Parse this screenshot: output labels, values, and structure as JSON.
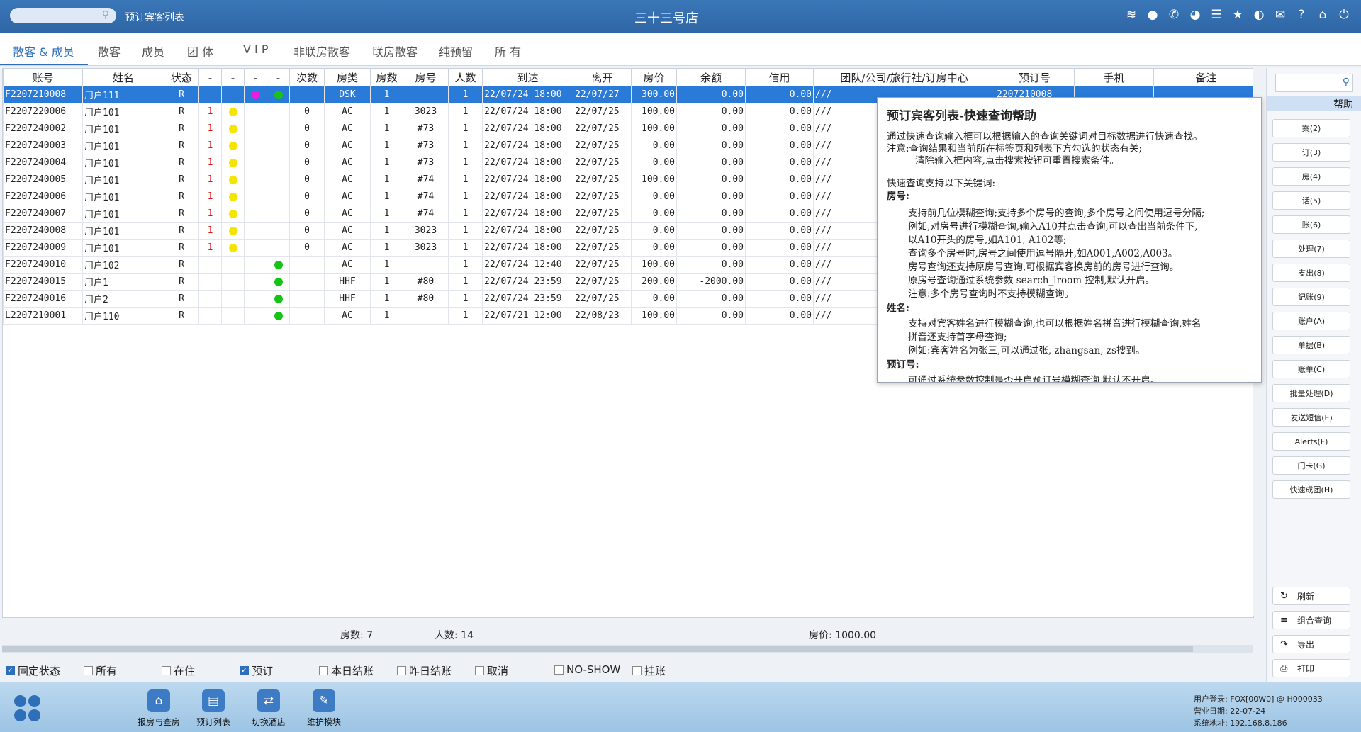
{
  "header": {
    "breadcrumb": "预订宾客列表",
    "store_name": "三十三号店",
    "icons": [
      "wifi-icon",
      "chat-icon",
      "phone-icon",
      "palette-icon",
      "menu-icon",
      "star-icon",
      "theme-icon",
      "mail-icon",
      "help-icon",
      "home-icon",
      "power-icon"
    ]
  },
  "tabs": [
    "散客 & 成员",
    "散客",
    "成员",
    "团 体",
    "V I P",
    "非联房散客",
    "联房散客",
    "纯预留",
    "所 有"
  ],
  "table": {
    "columns": [
      "账号",
      "姓名",
      "状态",
      "-",
      "-",
      "-",
      "-",
      "次数",
      "房类",
      "房数",
      "房号",
      "人数",
      "到达",
      "离开",
      "房价",
      "余额",
      "信用",
      "团队/公司/旅行社/订房中心",
      "预订号",
      "手机",
      "备注"
    ],
    "rows": [
      {
        "id": "F2207210008",
        "name": "用户111",
        "status": "R",
        "n1": "",
        "d1": "",
        "d2": "magenta",
        "d3": "green",
        "times": "",
        "type": "DSK",
        "rooms": "1",
        "roomno": "",
        "people": "1",
        "arrive": "22/07/24 18:00",
        "leave": "22/07/27",
        "price": "300.00",
        "balance": "0.00",
        "credit": "0.00",
        "group": "///",
        "resno": "2207210008",
        "mobile": "",
        "note": ""
      },
      {
        "id": "F2207220006",
        "name": "用户101",
        "status": "R",
        "n1": "1",
        "d1": "yellow",
        "d2": "",
        "d3": "",
        "times": "0",
        "type": "AC",
        "rooms": "1",
        "roomno": "3023",
        "people": "1",
        "arrive": "22/07/24 18:00",
        "leave": "22/07/25",
        "price": "100.00",
        "balance": "0.00",
        "credit": "0.00",
        "group": "///",
        "resno": "",
        "mobile": "",
        "note": ""
      },
      {
        "id": "F2207240002",
        "name": "用户101",
        "status": "R",
        "n1": "1",
        "d1": "yellow",
        "d2": "",
        "d3": "",
        "times": "0",
        "type": "AC",
        "rooms": "1",
        "roomno": "#73",
        "people": "1",
        "arrive": "22/07/24 18:00",
        "leave": "22/07/25",
        "price": "100.00",
        "balance": "0.00",
        "credit": "0.00",
        "group": "///",
        "resno": "",
        "mobile": "",
        "note": ""
      },
      {
        "id": "F2207240003",
        "name": "用户101",
        "status": "R",
        "n1": "1",
        "d1": "yellow",
        "d2": "",
        "d3": "",
        "times": "0",
        "type": "AC",
        "rooms": "1",
        "roomno": "#73",
        "people": "1",
        "arrive": "22/07/24 18:00",
        "leave": "22/07/25",
        "price": "0.00",
        "balance": "0.00",
        "credit": "0.00",
        "group": "///",
        "resno": "",
        "mobile": "",
        "note": ""
      },
      {
        "id": "F2207240004",
        "name": "用户101",
        "status": "R",
        "n1": "1",
        "d1": "yellow",
        "d2": "",
        "d3": "",
        "times": "0",
        "type": "AC",
        "rooms": "1",
        "roomno": "#73",
        "people": "1",
        "arrive": "22/07/24 18:00",
        "leave": "22/07/25",
        "price": "0.00",
        "balance": "0.00",
        "credit": "0.00",
        "group": "///",
        "resno": "",
        "mobile": "",
        "note": ""
      },
      {
        "id": "F2207240005",
        "name": "用户101",
        "status": "R",
        "n1": "1",
        "d1": "yellow",
        "d2": "",
        "d3": "",
        "times": "0",
        "type": "AC",
        "rooms": "1",
        "roomno": "#74",
        "people": "1",
        "arrive": "22/07/24 18:00",
        "leave": "22/07/25",
        "price": "100.00",
        "balance": "0.00",
        "credit": "0.00",
        "group": "///",
        "resno": "",
        "mobile": "",
        "note": ""
      },
      {
        "id": "F2207240006",
        "name": "用户101",
        "status": "R",
        "n1": "1",
        "d1": "yellow",
        "d2": "",
        "d3": "",
        "times": "0",
        "type": "AC",
        "rooms": "1",
        "roomno": "#74",
        "people": "1",
        "arrive": "22/07/24 18:00",
        "leave": "22/07/25",
        "price": "0.00",
        "balance": "0.00",
        "credit": "0.00",
        "group": "///",
        "resno": "",
        "mobile": "",
        "note": ""
      },
      {
        "id": "F2207240007",
        "name": "用户101",
        "status": "R",
        "n1": "1",
        "d1": "yellow",
        "d2": "",
        "d3": "",
        "times": "0",
        "type": "AC",
        "rooms": "1",
        "roomno": "#74",
        "people": "1",
        "arrive": "22/07/24 18:00",
        "leave": "22/07/25",
        "price": "0.00",
        "balance": "0.00",
        "credit": "0.00",
        "group": "///",
        "resno": "",
        "mobile": "",
        "note": ""
      },
      {
        "id": "F2207240008",
        "name": "用户101",
        "status": "R",
        "n1": "1",
        "d1": "yellow",
        "d2": "",
        "d3": "",
        "times": "0",
        "type": "AC",
        "rooms": "1",
        "roomno": "3023",
        "people": "1",
        "arrive": "22/07/24 18:00",
        "leave": "22/07/25",
        "price": "0.00",
        "balance": "0.00",
        "credit": "0.00",
        "group": "///",
        "resno": "",
        "mobile": "",
        "note": ""
      },
      {
        "id": "F2207240009",
        "name": "用户101",
        "status": "R",
        "n1": "1",
        "d1": "yellow",
        "d2": "",
        "d3": "",
        "times": "0",
        "type": "AC",
        "rooms": "1",
        "roomno": "3023",
        "people": "1",
        "arrive": "22/07/24 18:00",
        "leave": "22/07/25",
        "price": "0.00",
        "balance": "0.00",
        "credit": "0.00",
        "group": "///",
        "resno": "",
        "mobile": "",
        "note": ""
      },
      {
        "id": "F2207240010",
        "name": "用户102",
        "status": "R",
        "n1": "",
        "d1": "",
        "d2": "",
        "d3": "green",
        "times": "",
        "type": "AC",
        "rooms": "1",
        "roomno": "",
        "people": "1",
        "arrive": "22/07/24 12:40",
        "leave": "22/07/25",
        "price": "100.00",
        "balance": "0.00",
        "credit": "0.00",
        "group": "///",
        "resno": "",
        "mobile": "",
        "note": ""
      },
      {
        "id": "F2207240015",
        "name": "用户1",
        "status": "R",
        "n1": "",
        "d1": "",
        "d2": "",
        "d3": "green",
        "times": "",
        "type": "HHF",
        "rooms": "1",
        "roomno": "#80",
        "people": "1",
        "arrive": "22/07/24 23:59",
        "leave": "22/07/25",
        "price": "200.00",
        "balance": "-2000.00",
        "credit": "0.00",
        "group": "///",
        "resno": "",
        "mobile": "",
        "note": ""
      },
      {
        "id": "F2207240016",
        "name": "用户2",
        "status": "R",
        "n1": "",
        "d1": "",
        "d2": "",
        "d3": "green",
        "times": "",
        "type": "HHF",
        "rooms": "1",
        "roomno": "#80",
        "people": "1",
        "arrive": "22/07/24 23:59",
        "leave": "22/07/25",
        "price": "0.00",
        "balance": "0.00",
        "credit": "0.00",
        "group": "///",
        "resno": "",
        "mobile": "",
        "note": ""
      },
      {
        "id": "L2207210001",
        "name": "用户110",
        "status": "R",
        "n1": "",
        "d1": "",
        "d2": "",
        "d3": "green",
        "times": "",
        "type": "AC",
        "rooms": "1",
        "roomno": "",
        "people": "1",
        "arrive": "22/07/21 12:00",
        "leave": "22/08/23",
        "price": "100.00",
        "balance": "0.00",
        "credit": "0.00",
        "group": "///",
        "resno": "",
        "mobile": "",
        "note": ""
      }
    ]
  },
  "summary": {
    "rooms": "房数: 7",
    "people": "人数: 14",
    "price": "房价: 1000.00"
  },
  "filters": [
    {
      "label": "固定状态",
      "checked": true
    },
    {
      "label": "所有",
      "checked": false
    },
    {
      "label": "在住",
      "checked": false
    },
    {
      "label": "预订",
      "checked": true
    },
    {
      "label": "本日结账",
      "checked": false
    },
    {
      "label": "昨日结账",
      "checked": false
    },
    {
      "label": "取消",
      "checked": false
    },
    {
      "label": "NO-SHOW",
      "checked": false
    },
    {
      "label": "挂账",
      "checked": false
    }
  ],
  "right_panel": {
    "help_label": "帮助",
    "buttons": [
      "案(2)",
      "订(3)",
      "房(4)",
      "话(5)",
      "账(6)",
      "处理(7)",
      "支出(8)",
      "记账(9)",
      "账户(A)",
      "单据(B)",
      "账单(C)",
      "批量处理(D)",
      "发送短信(E)",
      "Alerts(F)",
      "门卡(G)",
      "快速成团(H)"
    ],
    "bottom_buttons": [
      {
        "label": "刷新",
        "icon": "refresh-icon"
      },
      {
        "label": "组合查询",
        "icon": "list-icon"
      },
      {
        "label": "导出",
        "icon": "export-icon"
      },
      {
        "label": "打印",
        "icon": "print-icon"
      }
    ]
  },
  "help": {
    "title": "预订宾客列表-快速查询帮助",
    "lines": [
      "通过快速查询输入框可以根据输入的查询关键词对目标数据进行快速查找。",
      "注意:查询结果和当前所在标签页和列表下方勾选的状态有关;",
      "清除输入框内容,点击搜索按钮可重置搜索条件。",
      "快速查询支持以下关键词:",
      "房号:",
      "支持前几位模糊查询;支持多个房号的查询,多个房号之间使用逗号分隔;",
      "例如,对房号进行模糊查询,输入A10并点击查询,可以查出当前条件下,",
      "以A10开头的房号,如A101, A102等;",
      "查询多个房号时,房号之间使用逗号隔开,如A001,A002,A003。",
      "房号查询还支持原房号查询,可根据宾客换房前的房号进行查询。",
      "原房号查询通过系统参数 search_lroom 控制,默认开启。",
      "注意:多个房号查询时不支持模糊查询。",
      "姓名:",
      "支持对宾客姓名进行模糊查询,也可以根据姓名拼音进行模糊查询,姓名",
      "拼音还支持首字母查询;",
      "例如:宾客姓名为张三,可以通过张, zhangsan, zs搜到。",
      "预订号:",
      "可通过系统参数控制是否开启预订号模糊查询,默认不开启。"
    ]
  },
  "footer": {
    "buttons": [
      {
        "label": "报房与查房",
        "icon": "house-search-icon"
      },
      {
        "label": "预订列表",
        "icon": "booking-list-icon"
      },
      {
        "label": "切换酒店",
        "icon": "switch-icon"
      },
      {
        "label": "维护模块",
        "icon": "wrench-icon"
      }
    ],
    "info": [
      "用户登录: FOX[00W0] @ H000033",
      "营业日期: 22-07-24",
      "系统地址: 192.168.8.186"
    ]
  }
}
